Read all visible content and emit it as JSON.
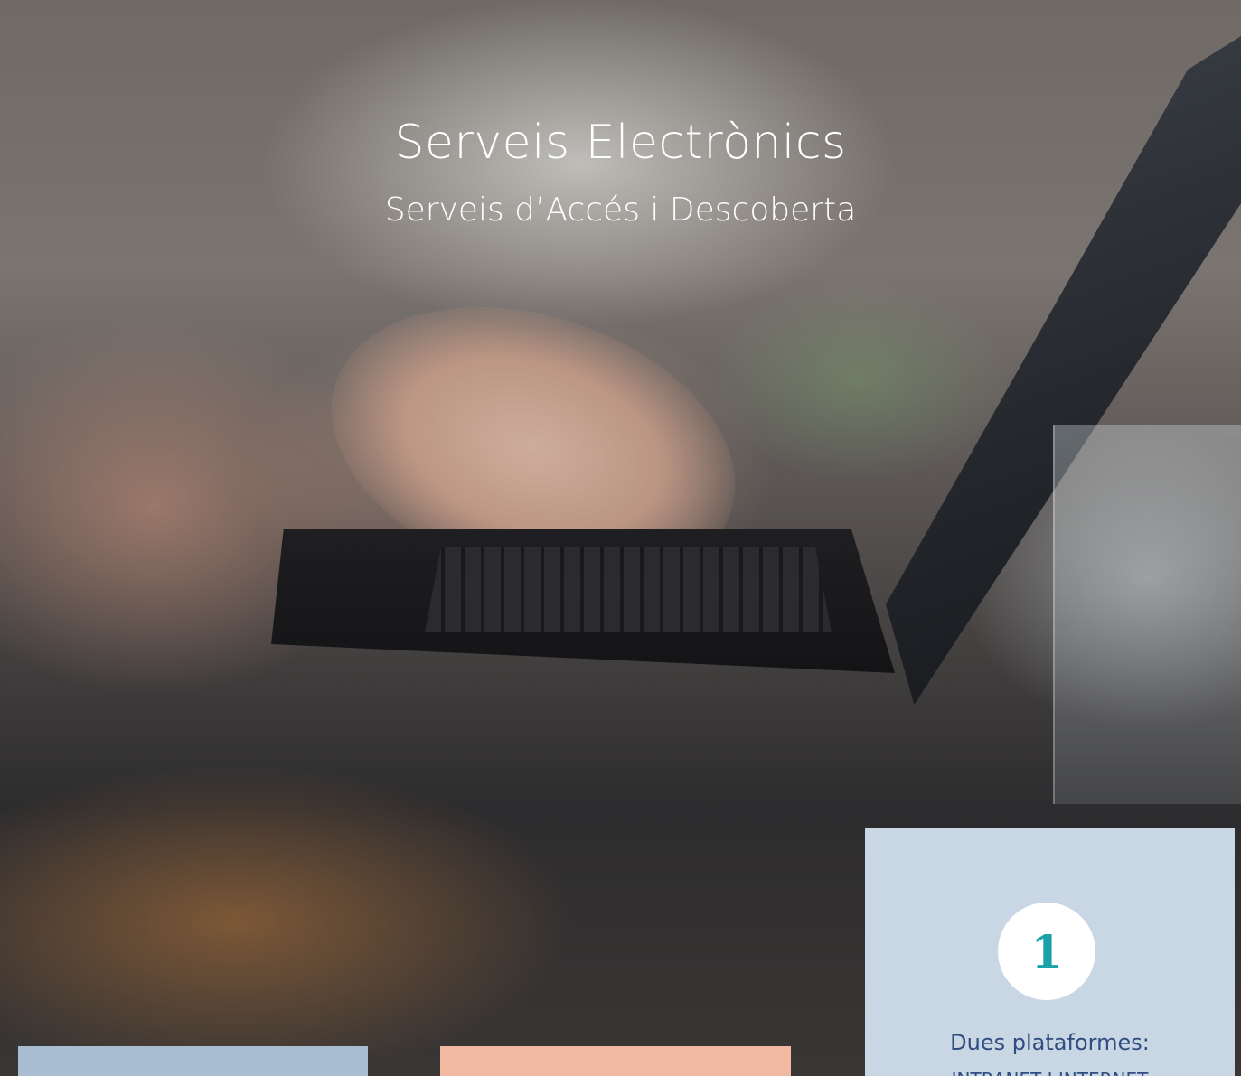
{
  "hero": {
    "title": "Serveis Electrònics",
    "subtitle": "Serveis d’Accés i Descoberta"
  },
  "info_card": {
    "number": "1",
    "text": "Dues plataformes:",
    "text_secondary": "INTRANET I INTERNET"
  },
  "colors": {
    "top_bar": "#1d76c8",
    "card_blue": "#a8bdd2",
    "card_peach": "#f1b9a1",
    "card_info": "#c9d6e3",
    "badge_number": "#1aa2a8",
    "info_text": "#2f4d80"
  }
}
